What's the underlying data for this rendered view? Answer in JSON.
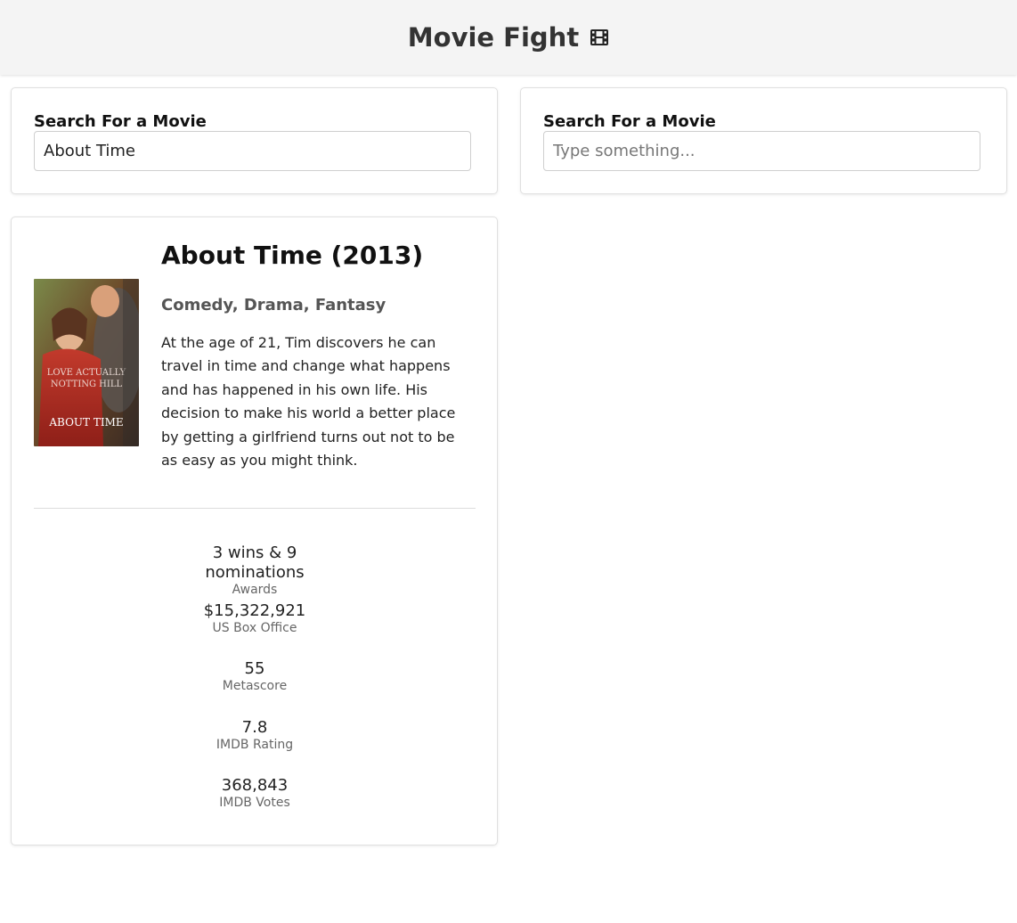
{
  "header": {
    "title": "Movie Fight"
  },
  "search_left": {
    "label": "Search For a Movie",
    "value": "About Time",
    "placeholder": "Type something..."
  },
  "search_right": {
    "label": "Search For a Movie",
    "value": "",
    "placeholder": "Type something..."
  },
  "movie": {
    "title": "About Time (2013)",
    "genres": "Comedy, Drama, Fantasy",
    "plot": "At the age of 21, Tim discovers he can travel in time and change what happens and has happened in his own life. His decision to make his world a better place by getting a girlfriend turns out not to be as easy as you might think.",
    "poster_text": "ABOUT TIME",
    "poster_tagline": "LOVE ACTUALLY NOTTING HILL"
  },
  "stats": [
    {
      "value": "3 wins & 9 nominations",
      "label": "Awards"
    },
    {
      "value": "$15,322,921",
      "label": "US Box Office"
    },
    {
      "value": "55",
      "label": "Metascore"
    },
    {
      "value": "7.8",
      "label": "IMDB Rating"
    },
    {
      "value": "368,843",
      "label": "IMDB Votes"
    }
  ]
}
